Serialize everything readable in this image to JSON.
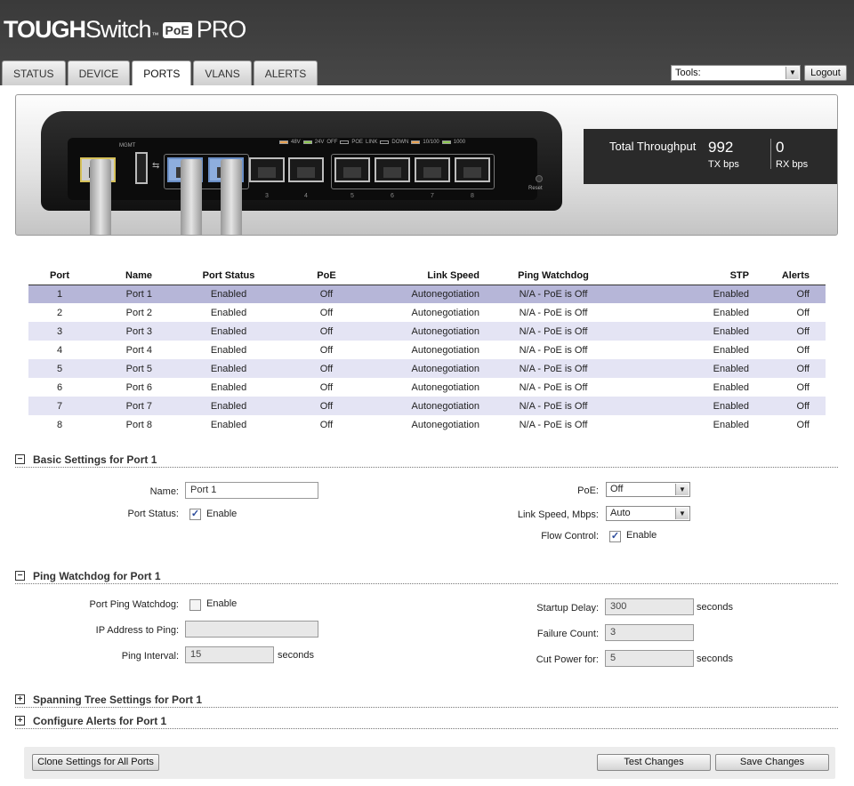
{
  "logo": {
    "tough": "TOUGH",
    "switch": "Switch",
    "tm": "™",
    "poe": "PoE",
    "pro": "PRO"
  },
  "tabs": [
    {
      "label": "STATUS",
      "active": false
    },
    {
      "label": "DEVICE",
      "active": false
    },
    {
      "label": "PORTS",
      "active": true
    },
    {
      "label": "VLANS",
      "active": false
    },
    {
      "label": "ALERTS",
      "active": false
    }
  ],
  "tools": {
    "selected": "Tools:"
  },
  "logout_label": "Logout",
  "device": {
    "mgmt_label": "MGMT",
    "legend": {
      "v48": "48V",
      "v24": "24V",
      "off": "OFF",
      "poe": "POE",
      "link": "LINK",
      "down": "DOWN",
      "s10100": "10/100",
      "s1000": "1000"
    },
    "port_numbers": [
      "3",
      "4",
      "5",
      "6",
      "7",
      "8"
    ],
    "reset_label": "Reset"
  },
  "throughput": {
    "label": "Total Throughput",
    "tx_value": "992",
    "tx_unit": "TX bps",
    "rx_value": "0",
    "rx_unit": "RX bps"
  },
  "ports_table": {
    "headers": {
      "port": "Port",
      "name": "Name",
      "status": "Port Status",
      "poe": "PoE",
      "speed": "Link Speed",
      "ping": "Ping Watchdog",
      "stp": "STP",
      "alerts": "Alerts"
    },
    "rows": [
      {
        "port": "1",
        "name": "Port 1",
        "status": "Enabled",
        "poe": "Off",
        "speed": "Autonegotiation",
        "ping": "N/A - PoE is Off",
        "stp": "Enabled",
        "alerts": "Off"
      },
      {
        "port": "2",
        "name": "Port 2",
        "status": "Enabled",
        "poe": "Off",
        "speed": "Autonegotiation",
        "ping": "N/A - PoE is Off",
        "stp": "Enabled",
        "alerts": "Off"
      },
      {
        "port": "3",
        "name": "Port 3",
        "status": "Enabled",
        "poe": "Off",
        "speed": "Autonegotiation",
        "ping": "N/A - PoE is Off",
        "stp": "Enabled",
        "alerts": "Off"
      },
      {
        "port": "4",
        "name": "Port 4",
        "status": "Enabled",
        "poe": "Off",
        "speed": "Autonegotiation",
        "ping": "N/A - PoE is Off",
        "stp": "Enabled",
        "alerts": "Off"
      },
      {
        "port": "5",
        "name": "Port 5",
        "status": "Enabled",
        "poe": "Off",
        "speed": "Autonegotiation",
        "ping": "N/A - PoE is Off",
        "stp": "Enabled",
        "alerts": "Off"
      },
      {
        "port": "6",
        "name": "Port 6",
        "status": "Enabled",
        "poe": "Off",
        "speed": "Autonegotiation",
        "ping": "N/A - PoE is Off",
        "stp": "Enabled",
        "alerts": "Off"
      },
      {
        "port": "7",
        "name": "Port 7",
        "status": "Enabled",
        "poe": "Off",
        "speed": "Autonegotiation",
        "ping": "N/A - PoE is Off",
        "stp": "Enabled",
        "alerts": "Off"
      },
      {
        "port": "8",
        "name": "Port 8",
        "status": "Enabled",
        "poe": "Off",
        "speed": "Autonegotiation",
        "ping": "N/A - PoE is Off",
        "stp": "Enabled",
        "alerts": "Off"
      }
    ]
  },
  "basic": {
    "title": "Basic Settings for Port 1",
    "toggle": "−",
    "name_label": "Name:",
    "name_value": "Port 1",
    "status_label": "Port Status:",
    "status_check": "✓",
    "status_enable": "Enable",
    "poe_label": "PoE:",
    "poe_value": "Off",
    "speed_label": "Link Speed, Mbps:",
    "speed_value": "Auto",
    "flow_label": "Flow Control:",
    "flow_check": "✓",
    "flow_enable": "Enable"
  },
  "ping": {
    "title": "Ping Watchdog for Port 1",
    "toggle": "−",
    "watchdog_label": "Port Ping Watchdog:",
    "watchdog_enable": "Enable",
    "ip_label": "IP Address to Ping:",
    "ip_value": "",
    "interval_label": "Ping Interval:",
    "interval_value": "15",
    "interval_unit": "seconds",
    "startup_label": "Startup Delay:",
    "startup_value": "300",
    "startup_unit": "seconds",
    "failure_label": "Failure Count:",
    "failure_value": "3",
    "cut_label": "Cut Power for:",
    "cut_value": "5",
    "cut_unit": "seconds"
  },
  "stp_section": {
    "title": "Spanning Tree Settings for Port 1",
    "toggle": "+"
  },
  "alerts_section": {
    "title": "Configure Alerts for Port 1",
    "toggle": "+"
  },
  "buttons": {
    "clone": "Clone Settings for All Ports",
    "test": "Test Changes",
    "save": "Save Changes"
  },
  "colors": {
    "header_bg": "#3c3c3c",
    "selected_row": "#b6b6d8",
    "alt_row": "#e4e4f4",
    "checkmark": "#2a4a9a"
  }
}
